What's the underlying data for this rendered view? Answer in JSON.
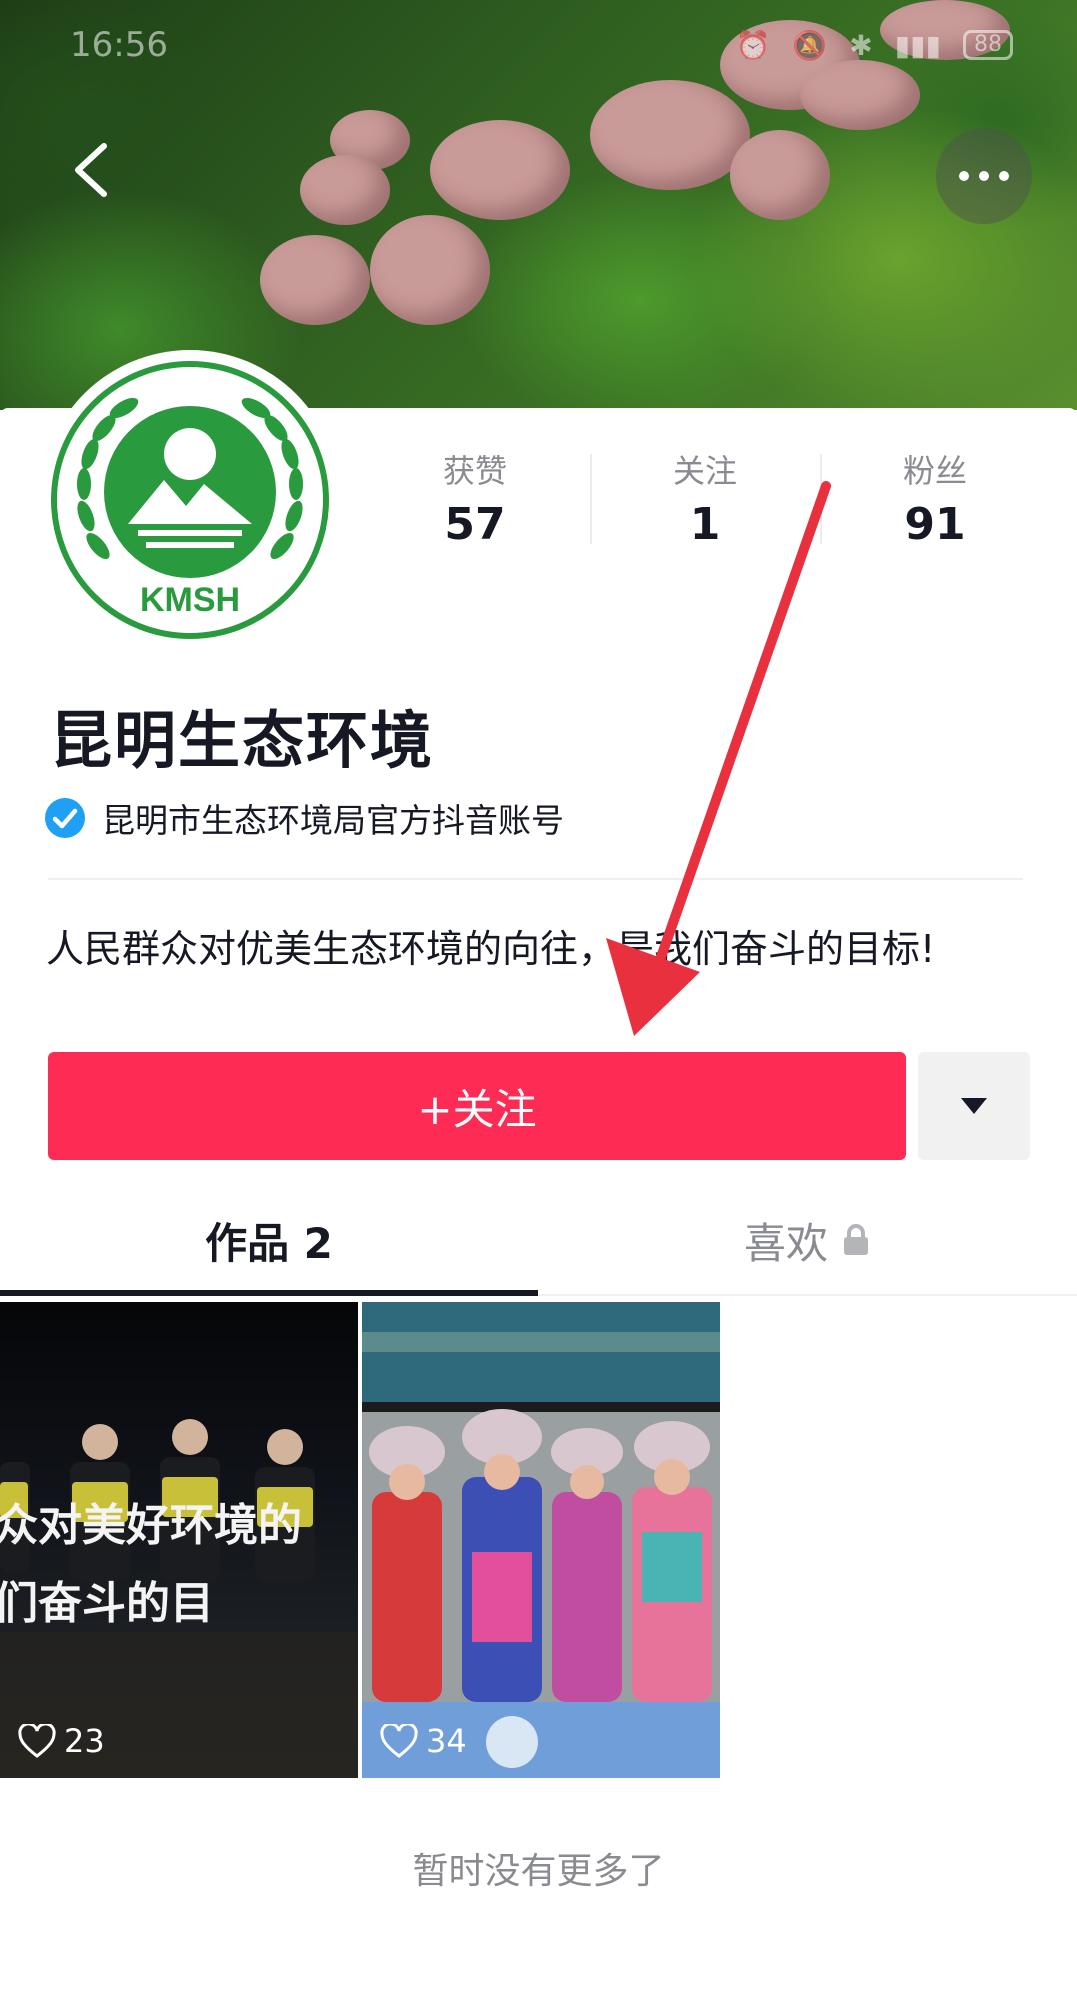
{
  "status_bar": {
    "time": "16:56",
    "battery": "88"
  },
  "profile": {
    "name": "昆明生态环境",
    "verified_text": "昆明市生态环境局官方抖音账号",
    "bio": "人民群众对优美生态环境的向往，是我们奋斗的目标!",
    "avatar_text": "KMSH",
    "stats": [
      {
        "label": "获赞",
        "value": "57"
      },
      {
        "label": "关注",
        "value": "1"
      },
      {
        "label": "粉丝",
        "value": "91"
      }
    ]
  },
  "actions": {
    "follow_label": "+关注"
  },
  "tabs": {
    "works_label": "作品 2",
    "likes_label": "喜欢"
  },
  "videos": [
    {
      "likes": "23",
      "caption_line1": "众对美好环境的",
      "caption_line2": "们奋斗的目"
    },
    {
      "likes": "34"
    }
  ],
  "footer": {
    "no_more": "暂时没有更多了"
  },
  "colors": {
    "accent": "#fe2c55",
    "verified": "#20a0f5",
    "logo_green": "#2a9a3e",
    "arrow": "#e8303e"
  }
}
